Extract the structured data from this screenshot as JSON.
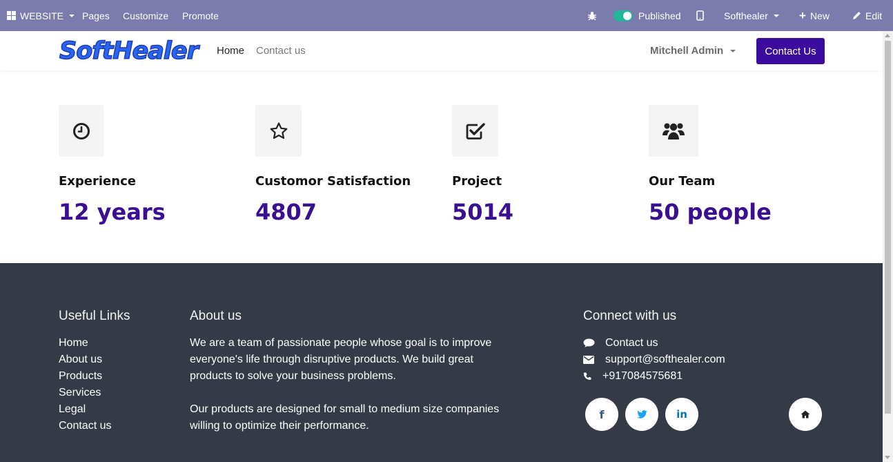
{
  "topbar": {
    "website_menu": "WEBSITE",
    "pages": "Pages",
    "customize": "Customize",
    "promote": "Promote",
    "published": "Published",
    "website_switcher": "Softhealer",
    "new": "New",
    "edit": "Edit",
    "bg_color": "#7c7bad",
    "toggle_color": "#21b799"
  },
  "header": {
    "logo_text": "SoftHealer",
    "nav": {
      "home": "Home",
      "contact": "Contact us"
    },
    "user": "Mitchell Admin",
    "cta": "Contact Us",
    "cta_color": "#3b0c9e"
  },
  "stats": [
    {
      "icon": "clock-icon",
      "title": "Experience",
      "value": "12 years"
    },
    {
      "icon": "star-icon",
      "title": "Customor Satisfaction",
      "value": "4807"
    },
    {
      "icon": "check-square-icon",
      "title": "Project",
      "value": "5014"
    },
    {
      "icon": "users-icon",
      "title": "Our Team",
      "value": "50 people"
    }
  ],
  "stat_value_color": "#3a0f92",
  "footer": {
    "bg_color": "#353b46",
    "useful_links_heading": "Useful Links",
    "useful_links": [
      "Home",
      "About us",
      "Products",
      "Services",
      "Legal",
      "Contact us"
    ],
    "about_heading": "About us",
    "about_p1": "We are a team of passionate people whose goal is to improve everyone's life through disruptive products. We build great products to solve your business problems.",
    "about_p2": "Our products are designed for small to medium size companies willing to optimize their performance.",
    "connect_heading": "Connect with us",
    "connect": {
      "contact": "Contact us",
      "email": "support@softhealer.com",
      "phone": "+917084575681"
    },
    "social": [
      "facebook-icon",
      "twitter-icon",
      "linkedin-icon"
    ],
    "home_icon": "home-icon"
  }
}
